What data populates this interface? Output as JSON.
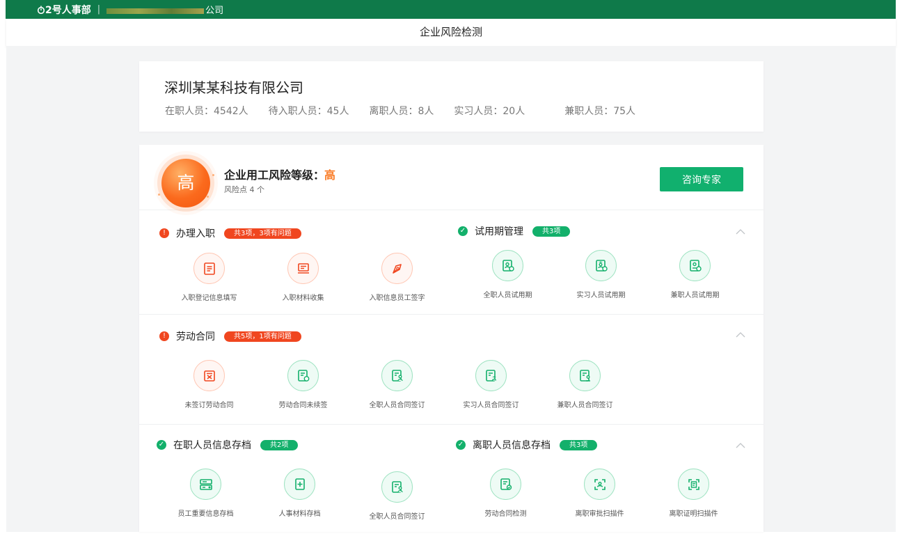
{
  "topbar": {
    "brand": "2号人事部",
    "company": "深圳某某科技有限公司",
    "company_visible_tail": "公司"
  },
  "appbar": {
    "title": "企业风险检测"
  },
  "company_card": {
    "name": "深圳某某科技有限公司",
    "stats": [
      "在职人员：4542人",
      "待入职人员：45人",
      "离职人员：8人",
      "实习人员：20人",
      "兼职人员：75人"
    ]
  },
  "risk": {
    "badge": "高",
    "title": "企业用工风险等级：",
    "level": "高",
    "points": "风险点 4 个",
    "consult_button": "咨询专家"
  },
  "sections": {
    "onboarding": {
      "title": "办理入职",
      "summary": "共3项，3项有问题",
      "items": [
        "入职登记信息填写",
        "入职材料收集",
        "入职信息员工签字"
      ]
    },
    "probation": {
      "title": "试用期管理",
      "summary": "共3项",
      "items": [
        "全职人员试用期",
        "实习人员试用期",
        "兼职人员试用期"
      ]
    },
    "contract": {
      "title": "劳动合同",
      "summary": "共5项，1项有问题",
      "items": [
        "未签订劳动合同",
        "劳动合同未续签",
        "全职人员合同签订",
        "实习人员合同签订",
        "兼职人员合同签订"
      ]
    },
    "active_archive": {
      "title": "在职人员信息存档",
      "summary": "共2项",
      "items": [
        "员工重要信息存档",
        "人事材料存档",
        "全职人员合同签订"
      ]
    },
    "leave_archive": {
      "title": "离职人员信息存档",
      "summary": "共3项",
      "items": [
        "劳动合同检测",
        "离职审批扫描件",
        "离职证明扫描件"
      ]
    }
  },
  "colors": {
    "topbar": "#0f7a4a",
    "accent_green": "#13b06b",
    "danger": "#f0461f",
    "risk_orange": "#fa7c26",
    "background": "#f3f4f5"
  },
  "icons": {
    "bad_status": "exclamation-circle-icon",
    "ok_status": "check-circle-icon",
    "collapse": "chevron-up-icon"
  }
}
